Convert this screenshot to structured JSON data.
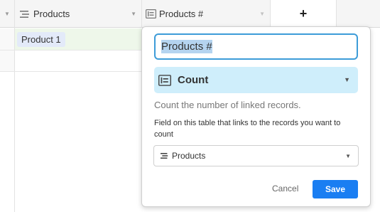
{
  "grid": {
    "columns": [
      {
        "name": "Products",
        "icon": "linked-record-icon"
      },
      {
        "name": "Products #",
        "icon": "count-field-icon"
      }
    ],
    "add_column_glyph": "+",
    "rows": [
      {
        "products": [
          "Product 1"
        ]
      }
    ]
  },
  "field_editor": {
    "field_name": "Products #",
    "field_type": {
      "label": "Count",
      "icon": "count-field-icon"
    },
    "description": "Count the number of linked records.",
    "link_field_help": "Field on this table that links to the records you want to count",
    "link_field": {
      "label": "Products",
      "icon": "linked-record-icon"
    },
    "cancel_label": "Cancel",
    "save_label": "Save"
  },
  "colors": {
    "accent": "#1a7ef2",
    "input_focus": "#3d9cd8",
    "type_select_bg": "#cfeefb",
    "selected_row_bg": "#eef7ea",
    "chip_bg": "#e3eaf9"
  }
}
